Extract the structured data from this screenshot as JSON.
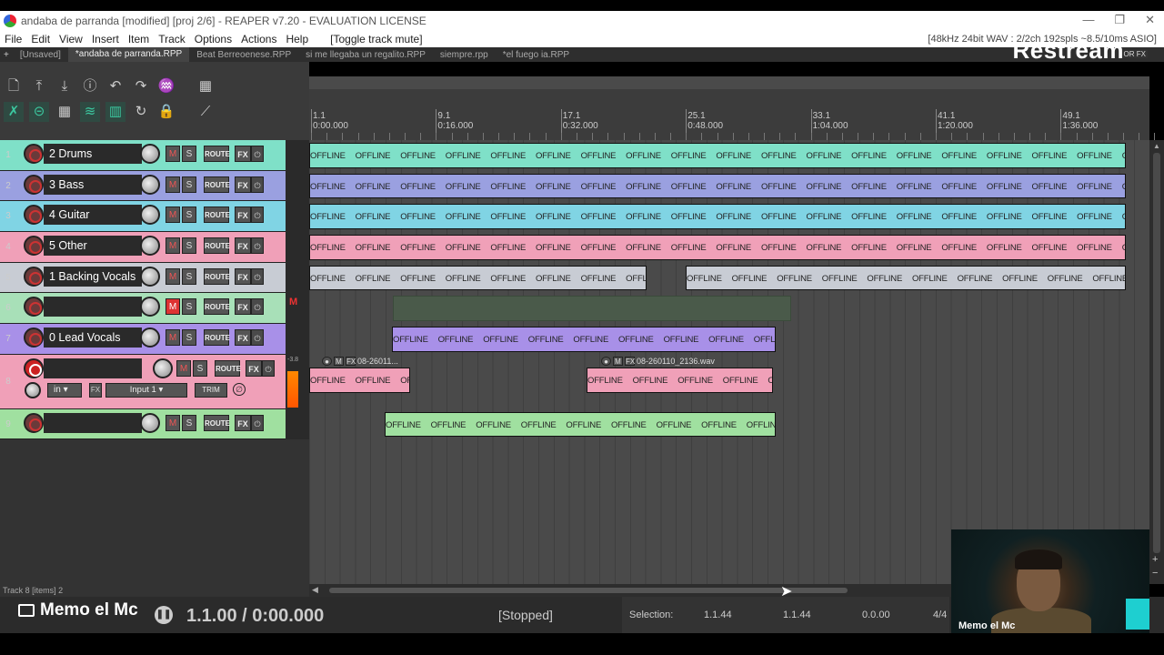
{
  "window": {
    "title": "andaba de parranda [modified] [proj 2/6] - REAPER v7.20 - EVALUATION LICENSE"
  },
  "menu": {
    "items": [
      "File",
      "Edit",
      "View",
      "Insert",
      "Item",
      "Track",
      "Options",
      "Actions",
      "Help"
    ],
    "toggle": "[Toggle track mute]",
    "audio_info": "[48kHz 24bit WAV : 2/2ch 192spls ~8.5/10ms ASIO]"
  },
  "project_tabs": [
    "[Unsaved]",
    "*andaba de parranda.RPP",
    "Beat Berreoenese.RPP",
    "si me llegaba un regalito.RPP",
    "siempre.rpp",
    "*el fuego ia.RPP"
  ],
  "overlay": {
    "brand": "Restream",
    "brand_sub": "OR FX"
  },
  "ruler": {
    "marks": [
      {
        "bar": "1.1",
        "time": "0:00.000"
      },
      {
        "bar": "9.1",
        "time": "0:16.000"
      },
      {
        "bar": "17.1",
        "time": "0:32.000"
      },
      {
        "bar": "25.1",
        "time": "0:48.000"
      },
      {
        "bar": "33.1",
        "time": "1:04.000"
      },
      {
        "bar": "41.1",
        "time": "1:20.000"
      },
      {
        "bar": "49.1",
        "time": "1:36.000"
      }
    ]
  },
  "tracks": [
    {
      "num": "1",
      "name": "2 Drums",
      "color": "#7fe0c8",
      "muted": false
    },
    {
      "num": "2",
      "name": "3 Bass",
      "color": "#9aa0e0",
      "muted": false
    },
    {
      "num": "3",
      "name": "4 Guitar",
      "color": "#80d4e4",
      "muted": false
    },
    {
      "num": "4",
      "name": "5 Other",
      "color": "#f0a0b8",
      "muted": false
    },
    {
      "num": "5",
      "name": "1 Backing Vocals",
      "color": "#c8ccd4",
      "muted": false
    },
    {
      "num": "6",
      "name": "",
      "color": "#a8e0b8",
      "muted": true
    },
    {
      "num": "7",
      "name": "0 Lead Vocals",
      "color": "#a890e8",
      "muted": false
    },
    {
      "num": "8",
      "name": "",
      "color": "#f0a0b8",
      "muted": false,
      "armed": true,
      "input_mode": "in",
      "input": "Input 1",
      "trim": "TRIM",
      "meter_db": "-3.8"
    },
    {
      "num": "9",
      "name": "",
      "color": "#a0e0a0",
      "muted": false
    }
  ],
  "buttons": {
    "mute": "M",
    "solo": "S",
    "route": "ROUTE",
    "fx": "FX",
    "pw": "⏻"
  },
  "item_label": "OFFLINE",
  "item_headers": {
    "h1": "08-26011...",
    "h2": "08-260110_2136.wav",
    "m": "M",
    "fx": "FX"
  },
  "mute_indicator": "M",
  "status": {
    "line": "Track 8 [items] 2"
  },
  "transport": {
    "position": "1.1.00 / 0:00.000",
    "state": "[Stopped]",
    "selection_label": "Selection:",
    "sel_start": "1.1.44",
    "sel_end": "1.1.44",
    "sel_len": "0.0.00",
    "timesig": "4/4"
  },
  "streamer": {
    "name": "Memo el Mc",
    "cam_name": "Memo el Mc"
  }
}
